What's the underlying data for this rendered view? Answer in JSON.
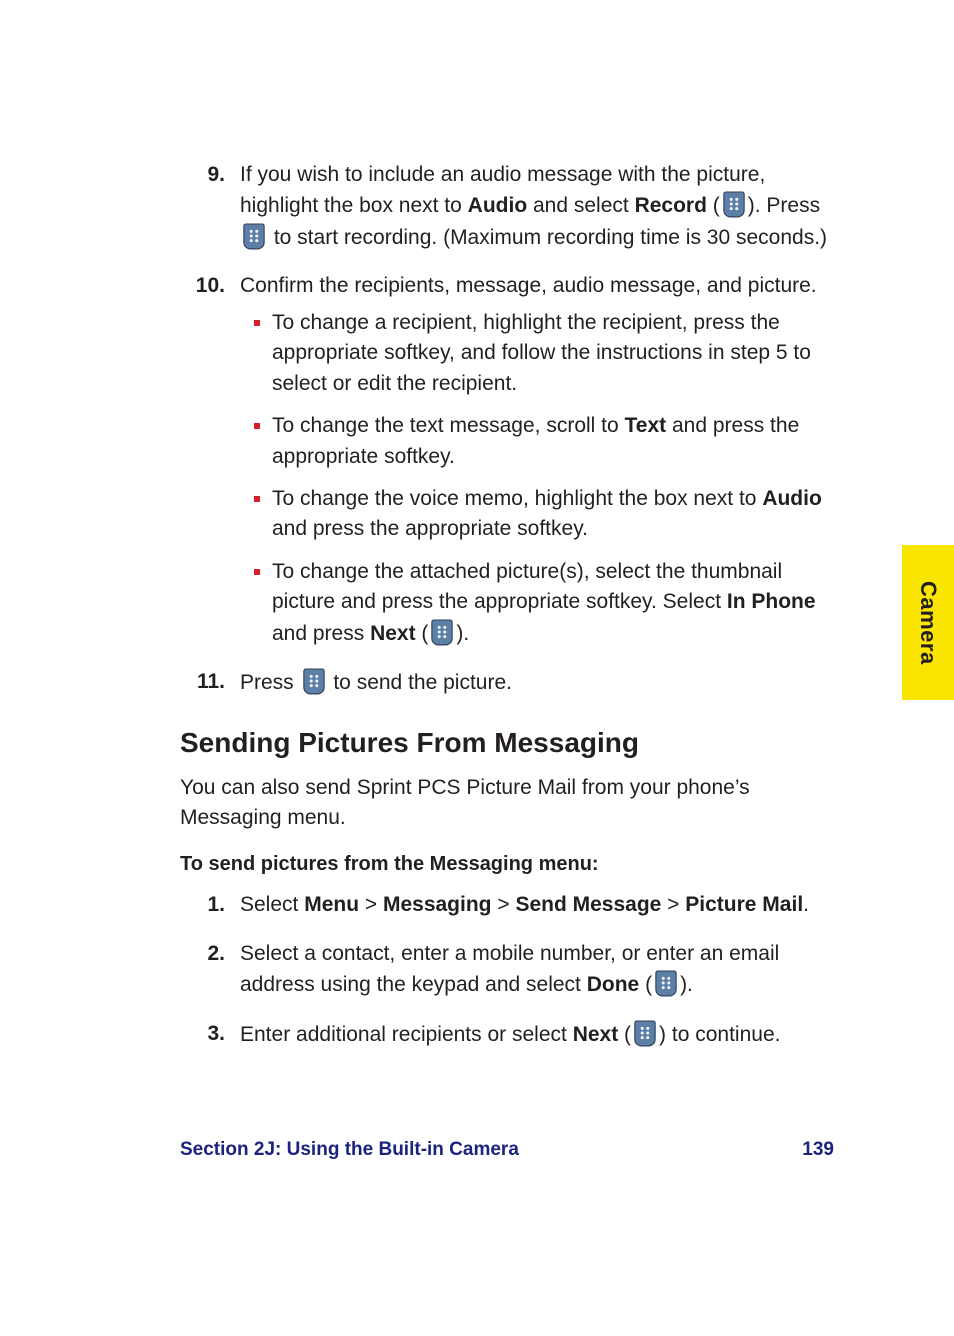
{
  "tab_label": "Camera",
  "steps_a": [
    {
      "num": "9.",
      "pre": "If you wish to include an audio message with the picture, highlight the box next to ",
      "bold1": "Audio",
      "mid1": " and select ",
      "bold2": "Record",
      "mid2": " (",
      "mid3": "). Press ",
      "post": " to start recording. (Maximum recording time is 30 seconds.)"
    },
    {
      "num": "10.",
      "text": "Confirm the recipients, message, audio message, and picture.",
      "subs": [
        {
          "text": "To change a recipient, highlight the recipient, press the appropriate softkey, and follow the instructions in step 5 to select or edit the recipient."
        },
        {
          "pre": "To change the text message, scroll to ",
          "bold1": "Text",
          "post": " and press the appropriate softkey."
        },
        {
          "pre": "To change the voice memo, highlight the box next to ",
          "bold1": "Audio",
          "post": " and press the appropriate softkey."
        },
        {
          "pre": "To change the attached picture(s), select the thumbnail picture and press the appropriate softkey. Select ",
          "bold1": "In Phone",
          "mid": " and press ",
          "bold2": "Next",
          "mid2": " (",
          "post": ")."
        }
      ]
    },
    {
      "num": "11.",
      "pre": "Press ",
      "post": " to send the picture."
    }
  ],
  "heading": "Sending Pictures From Messaging",
  "intro": "You can also send Sprint PCS Picture Mail from your phone’s Messaging menu.",
  "lead": "To send pictures from the Messaging menu:",
  "steps_b": [
    {
      "num": "1.",
      "pre": "Select ",
      "parts": [
        "Menu",
        "Messaging",
        "Send Message",
        "Picture Mail"
      ],
      "sep": " > ",
      "end": "."
    },
    {
      "num": "2.",
      "pre": "Select a contact, enter a mobile number, or enter an email address using the keypad and select ",
      "bold1": "Done",
      "mid1": " (",
      "post": ")."
    },
    {
      "num": "3.",
      "pre": "Enter additional recipients or select ",
      "bold1": "Next",
      "mid1": " (",
      "post": ") to continue."
    }
  ],
  "footer_left": "Section 2J: Using the Built-in Camera",
  "footer_right": "139"
}
